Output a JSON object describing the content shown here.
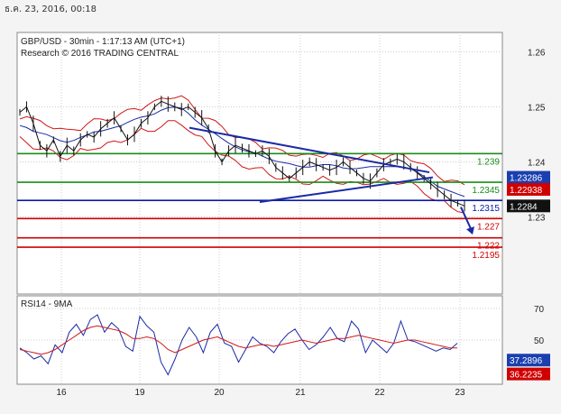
{
  "timestamp": "ธ.ค. 23, 2016, 00:18",
  "chart_data": [
    {
      "type": "line",
      "title": "GBP/USD - 30min - 1:17:13 AM (UTC+1)",
      "subtitle": "Research © 2016 TRADING CENTRAL",
      "y_ticks": [
        "1.26",
        "1.25",
        "1.24",
        "1.23"
      ],
      "ylim": [
        1.216,
        1.2635
      ],
      "x_ticks": [
        "16",
        "19",
        "20",
        "21",
        "22",
        "23"
      ],
      "grid": true,
      "levels": [
        {
          "label": "1.239",
          "value": 1.2415,
          "color": "#1a8c1a"
        },
        {
          "label": "1.2345",
          "value": 1.2363,
          "color": "#1a8c1a"
        },
        {
          "label": "1.2315",
          "value": 1.233,
          "color": "#0a1aa6"
        },
        {
          "label": "1.227",
          "value": 1.2297,
          "color": "#d00000"
        },
        {
          "label": "1.222",
          "value": 1.2262,
          "color": "#d00000"
        },
        {
          "label": "1.2195",
          "value": 1.2245,
          "color": "#d00000"
        }
      ],
      "price_tags": [
        {
          "label": "1.23286",
          "value": 1.2372,
          "color": "#1a3fb0"
        },
        {
          "label": "1.22938",
          "value": 1.235,
          "color": "#d00000"
        },
        {
          "label": "1.2284",
          "value": 1.232,
          "color": "#111111"
        }
      ],
      "price_series": [
        1.249,
        1.25,
        1.247,
        1.243,
        1.242,
        1.244,
        1.241,
        1.243,
        1.242,
        1.244,
        1.245,
        1.2445,
        1.246,
        1.247,
        1.248,
        1.246,
        1.244,
        1.245,
        1.247,
        1.248,
        1.25,
        1.251,
        1.2505,
        1.25,
        1.2495,
        1.25,
        1.249,
        1.248,
        1.246,
        1.242,
        1.24,
        1.242,
        1.243,
        1.2425,
        1.242,
        1.2415,
        1.242,
        1.241,
        1.239,
        1.238,
        1.237,
        1.238,
        1.239,
        1.24,
        1.2395,
        1.239,
        1.2385,
        1.239,
        1.24,
        1.239,
        1.238,
        1.237,
        1.2365,
        1.238,
        1.2395,
        1.24,
        1.2405,
        1.24,
        1.239,
        1.238,
        1.237,
        1.236,
        1.235,
        1.234,
        1.233,
        1.2325,
        1.232
      ]
    },
    {
      "type": "line",
      "title": "RSI14 - 9MA",
      "y_ticks": [
        "70",
        "50"
      ],
      "ylim": [
        22,
        78
      ],
      "series": [
        {
          "values": [
            45,
            42,
            38,
            40,
            35,
            47,
            42,
            55,
            60,
            53,
            63,
            66,
            55,
            61,
            57,
            46,
            43,
            65,
            59,
            55,
            36,
            28,
            38,
            50,
            58,
            52,
            42,
            55,
            60,
            48,
            46,
            36,
            44,
            52,
            48,
            46,
            42,
            49,
            54,
            57,
            50,
            44,
            47,
            52,
            58,
            51,
            49,
            62,
            57,
            42,
            50,
            46,
            42,
            48,
            62,
            50,
            49,
            47,
            45,
            43,
            45,
            44,
            48
          ]
        },
        {
          "values": [
            44,
            43,
            42,
            41,
            42,
            44,
            47,
            50,
            53,
            56,
            58,
            59,
            58,
            57,
            56,
            54,
            51,
            51,
            52,
            51,
            48,
            44,
            42,
            44,
            46,
            48,
            50,
            51,
            52,
            50,
            48,
            46,
            45,
            46,
            47,
            47,
            46,
            47,
            48,
            49,
            50,
            49,
            48,
            49,
            50,
            51,
            51,
            52,
            53,
            52,
            51,
            50,
            49,
            48,
            49,
            50,
            50,
            49,
            48,
            47,
            46,
            45,
            45
          ]
        }
      ],
      "tags": [
        {
          "label": "37.2896",
          "value": 37.29,
          "color": "#1a3fb0"
        },
        {
          "label": "36.2235",
          "value": 28.5,
          "color": "#d00000"
        }
      ]
    }
  ]
}
